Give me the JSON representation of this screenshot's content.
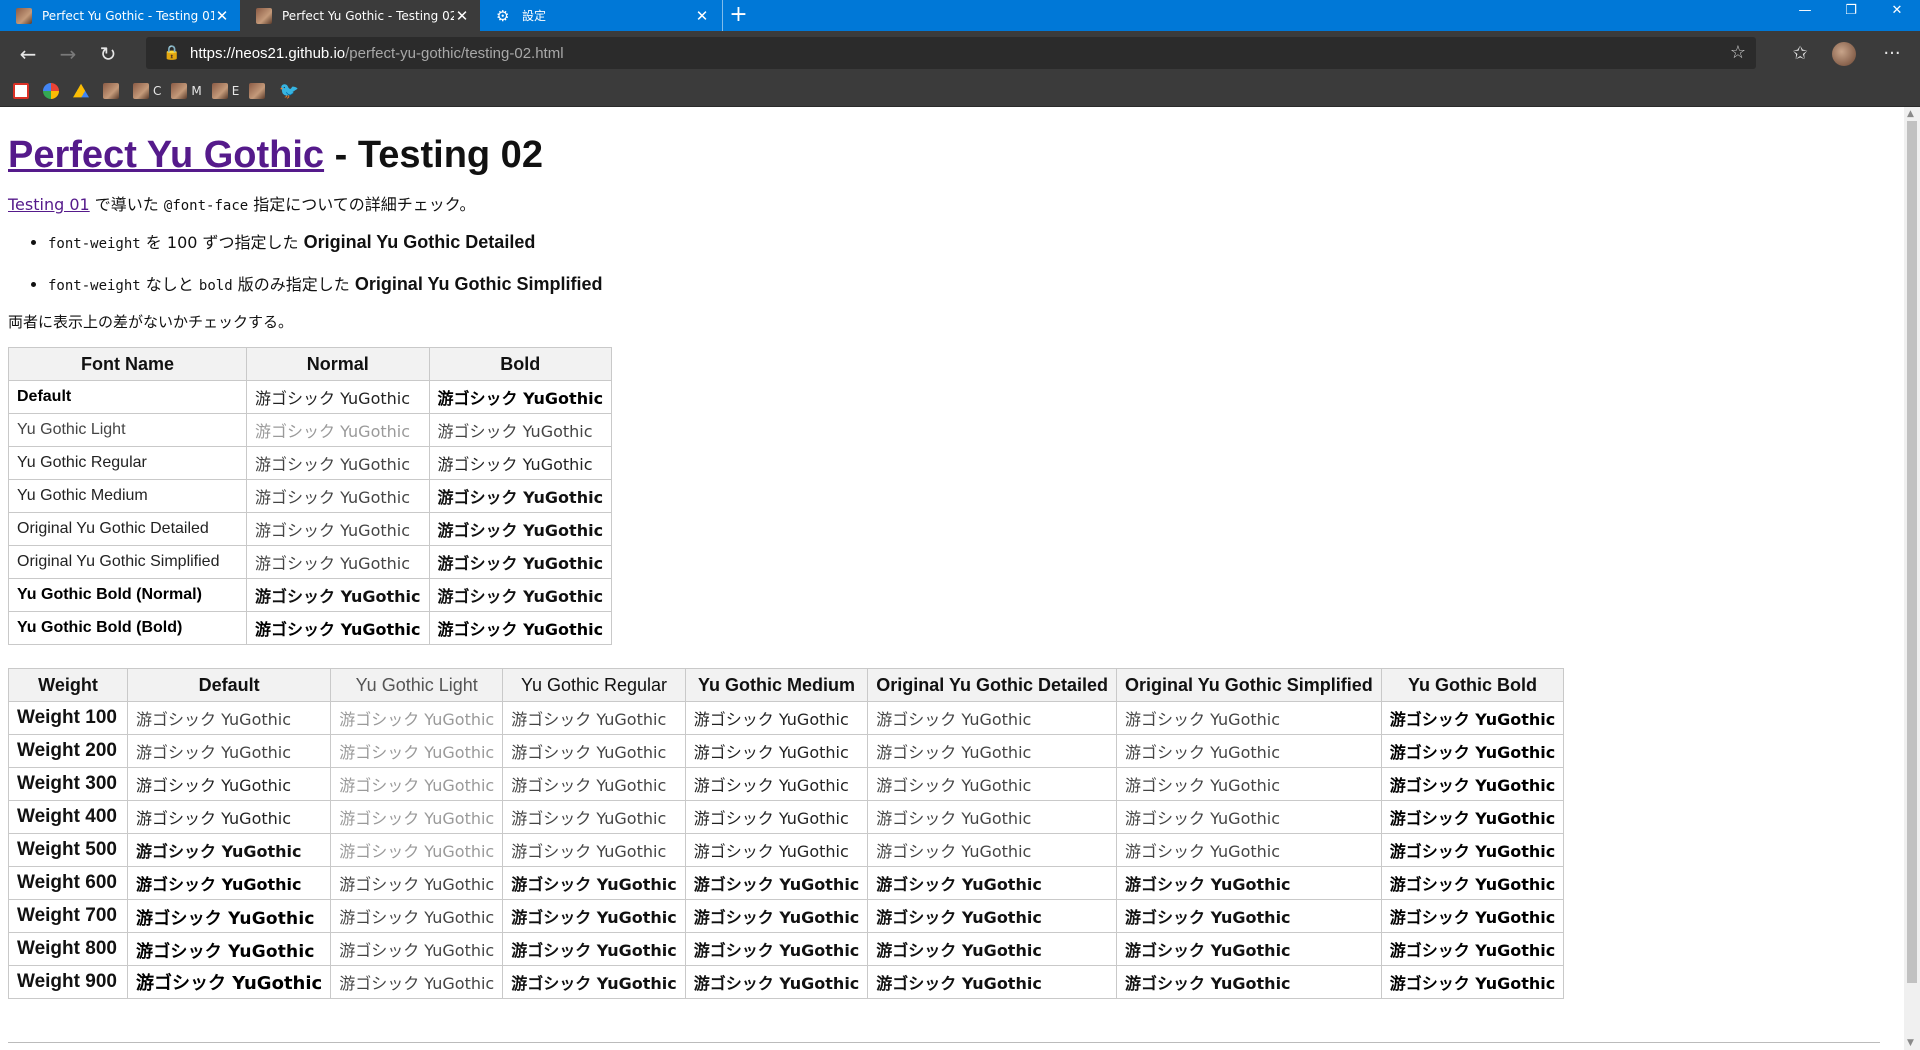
{
  "browser": {
    "tabs": [
      {
        "title": "Perfect Yu Gothic - Testing 01",
        "active": false,
        "icon": "site-favicon"
      },
      {
        "title": "Perfect Yu Gothic - Testing 02",
        "active": true,
        "icon": "site-favicon"
      },
      {
        "title": "設定",
        "active": false,
        "icon": "gear-icon"
      }
    ],
    "url_host": "https://neos21.github.io",
    "url_path": "/perfect-yu-gothic/testing-02.html",
    "bookmarks": [
      {
        "icon": "gmail-icon",
        "label": ""
      },
      {
        "icon": "google-icon",
        "label": ""
      },
      {
        "icon": "google-drive-icon",
        "label": ""
      },
      {
        "icon": "site-favicon",
        "label": ""
      },
      {
        "icon": "site-favicon",
        "label": "C"
      },
      {
        "icon": "site-favicon",
        "label": "M"
      },
      {
        "icon": "site-favicon",
        "label": "E"
      },
      {
        "icon": "site-favicon",
        "label": ""
      },
      {
        "icon": "twitter-icon",
        "label": ""
      }
    ],
    "colors": {
      "titlebar": "#0078d7",
      "toolbar": "#3b3b3b"
    }
  },
  "page": {
    "title_link": "Perfect Yu Gothic",
    "title_rest": " - Testing 02",
    "intro_link": "Testing 01",
    "intro_text_1": " で導いた ",
    "intro_code": "@font-face",
    "intro_text_2": " 指定についての詳細チェック。",
    "bullets": [
      {
        "code": "font-weight",
        "text": " を 100 ずつ指定した ",
        "bold": "Original Yu Gothic Detailed"
      },
      {
        "code": "font-weight",
        "text": " なしと ",
        "code2": "bold",
        "text2": " 版のみ指定した ",
        "bold": "Original Yu Gothic Simplified"
      }
    ],
    "conclusion": "両者に表示上の差がないかチェックする。",
    "sample": "游ゴシック YuGothic",
    "table1": {
      "headers": [
        "Font Name",
        "Normal",
        "Bold"
      ],
      "rows": [
        {
          "name": "Default",
          "name_style": "w-bold",
          "normal": "w-medium",
          "bold": "w-bold"
        },
        {
          "name": "Yu Gothic Light",
          "name_style": "w-regular",
          "normal": "w-light",
          "bold": "w-regular"
        },
        {
          "name": "Yu Gothic Regular",
          "name_style": "w-medium",
          "normal": "w-regular",
          "bold": "w-medium"
        },
        {
          "name": "Yu Gothic Medium",
          "name_style": "w-medium",
          "normal": "w-regular",
          "bold": "w-semibold"
        },
        {
          "name": "Original Yu Gothic Detailed",
          "name_style": "w-medium",
          "normal": "w-regular",
          "bold": "w-semibold"
        },
        {
          "name": "Original Yu Gothic Simplified",
          "name_style": "w-medium",
          "normal": "w-regular",
          "bold": "w-semibold"
        },
        {
          "name": "Yu Gothic Bold (Normal)",
          "name_style": "w-bold",
          "normal": "w-semibold",
          "bold": "w-semibold"
        },
        {
          "name": "Yu Gothic Bold (Bold)",
          "name_style": "w-bold",
          "normal": "w-bold",
          "bold": "w-bold"
        }
      ]
    },
    "table2": {
      "headers": [
        "Weight",
        "Default",
        "Yu Gothic Light",
        "Yu Gothic Regular",
        "Yu Gothic Medium",
        "Original Yu Gothic Detailed",
        "Original Yu Gothic Simplified",
        "Yu Gothic Bold"
      ],
      "rows": [
        {
          "label": "Weight 100",
          "styles": [
            "w-regular",
            "w-light",
            "w-regular",
            "w-medium",
            "w-regular",
            "w-regular",
            "w-bold"
          ]
        },
        {
          "label": "Weight 200",
          "styles": [
            "w-regular",
            "w-light",
            "w-regular",
            "w-medium",
            "w-regular",
            "w-regular",
            "w-bold"
          ]
        },
        {
          "label": "Weight 300",
          "styles": [
            "w-medium",
            "w-light",
            "w-regular",
            "w-medium",
            "w-regular",
            "w-regular",
            "w-bold"
          ]
        },
        {
          "label": "Weight 400",
          "styles": [
            "w-medium",
            "w-light",
            "w-regular",
            "w-medium",
            "w-regular",
            "w-regular",
            "w-bold"
          ]
        },
        {
          "label": "Weight 500",
          "styles": [
            "w-semibold",
            "w-light",
            "w-regular",
            "w-medium",
            "w-regular",
            "w-regular",
            "w-bold"
          ]
        },
        {
          "label": "Weight 600",
          "styles": [
            "w-bold",
            "w-regular",
            "w-semibold",
            "w-semibold",
            "w-semibold",
            "w-semibold",
            "w-bold"
          ]
        },
        {
          "label": "Weight 700",
          "styles": [
            "w-heavy",
            "w-regular",
            "w-semibold",
            "w-semibold",
            "w-semibold",
            "w-semibold",
            "w-bold"
          ]
        },
        {
          "label": "Weight 800",
          "styles": [
            "w-heavy",
            "w-regular",
            "w-semibold",
            "w-semibold",
            "w-semibold",
            "w-semibold",
            "w-bold"
          ]
        },
        {
          "label": "Weight 900",
          "styles": [
            "w-black",
            "w-regular",
            "w-semibold",
            "w-semibold",
            "w-semibold",
            "w-semibold",
            "w-bold"
          ]
        }
      ]
    }
  }
}
